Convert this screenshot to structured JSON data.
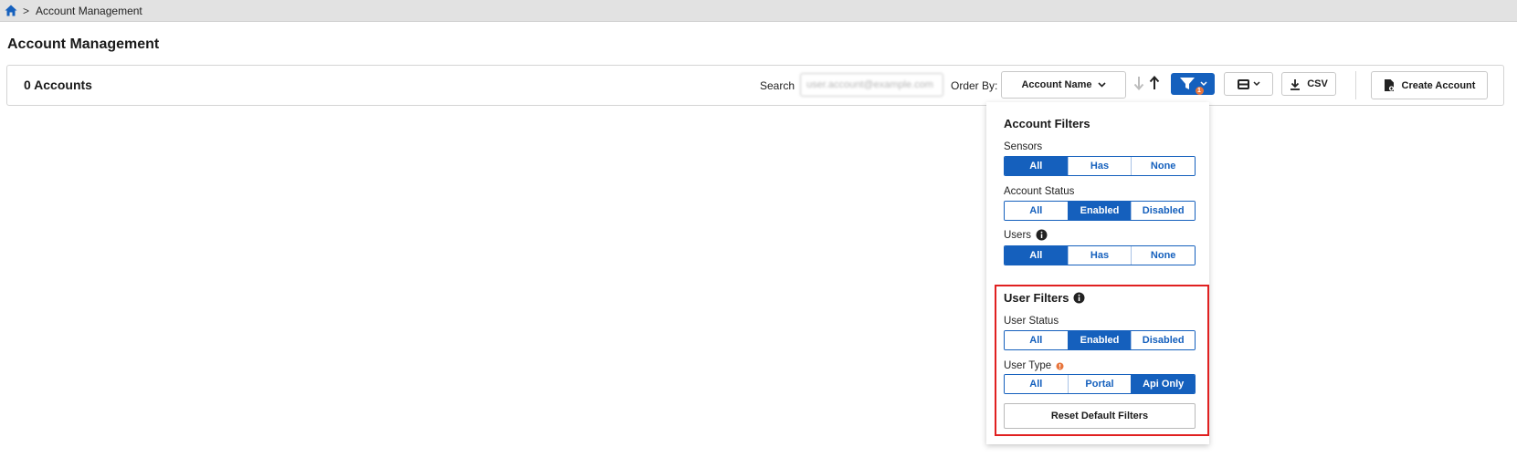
{
  "breadcrumb": {
    "home_icon": "home-icon",
    "separator": ">",
    "current": "Account Management"
  },
  "page": {
    "title": "Account Management"
  },
  "toolbar": {
    "count_label": "0 Accounts",
    "search_label": "Search",
    "search_value": "user.account@example.com",
    "order_by_label": "Order By:",
    "order_by_value": "Account Name",
    "filter_badge": "1",
    "csv_label": "CSV",
    "create_label": "Create Account"
  },
  "filters": {
    "account_title": "Account Filters",
    "sensors": {
      "label": "Sensors",
      "options": [
        "All",
        "Has",
        "None"
      ],
      "selected": "All"
    },
    "account_status": {
      "label": "Account Status",
      "options": [
        "All",
        "Enabled",
        "Disabled"
      ],
      "selected": "Enabled"
    },
    "users": {
      "label": "Users",
      "options": [
        "All",
        "Has",
        "None"
      ],
      "selected": "All"
    },
    "user_title": "User Filters",
    "user_status": {
      "label": "User Status",
      "options": [
        "All",
        "Enabled",
        "Disabled"
      ],
      "selected": "Enabled"
    },
    "user_type": {
      "label": "User Type",
      "options": [
        "All",
        "Portal",
        "Api Only"
      ],
      "selected": "Api Only"
    },
    "reset_label": "Reset Default Filters"
  },
  "colors": {
    "accent": "#1560bd",
    "highlight": "#e02020",
    "badge": "#e8753c"
  }
}
